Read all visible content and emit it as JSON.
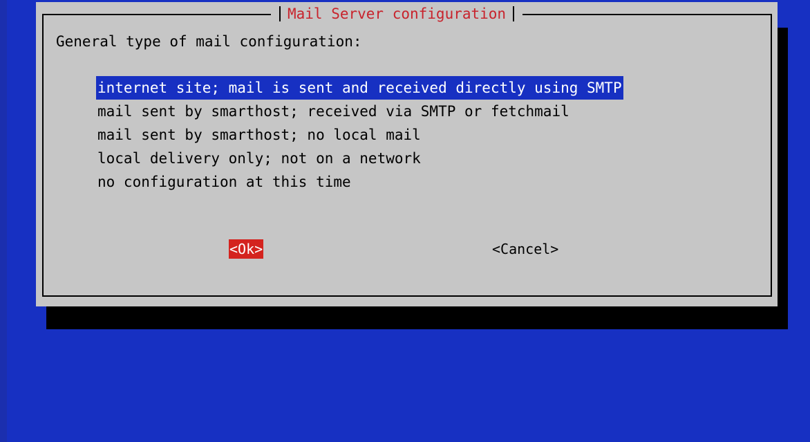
{
  "dialog": {
    "title": "Mail Server configuration",
    "prompt": "General type of mail configuration:",
    "options": [
      {
        "label": "internet site; mail is sent and received directly using SMTP",
        "selected": true
      },
      {
        "label": "mail sent by smarthost; received via SMTP or fetchmail",
        "selected": false
      },
      {
        "label": "mail sent by smarthost; no local mail",
        "selected": false
      },
      {
        "label": "local delivery only; not on a network",
        "selected": false
      },
      {
        "label": "no configuration at this time",
        "selected": false
      }
    ],
    "ok_label": "<Ok>",
    "cancel_label": "<Cancel>"
  },
  "colors": {
    "background": "#1730c2",
    "dialog": "#c6c6c6",
    "title": "#c8232c",
    "selection": "#1730c2",
    "ok_button": "#d4231e"
  }
}
